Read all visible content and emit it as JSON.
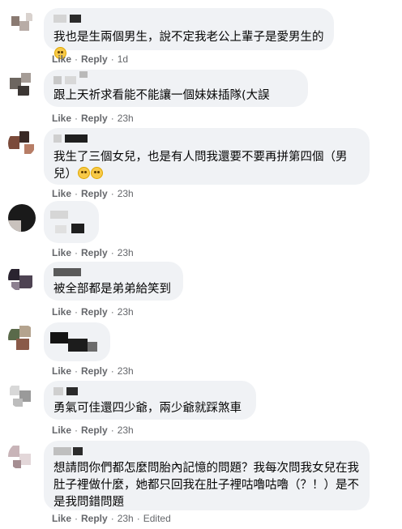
{
  "like_label": "Like",
  "reply_label": "Reply",
  "separator": "·",
  "comments": [
    {
      "text": "我也是生兩個男生，說不定我老公上輩子是愛男生的",
      "emoji": "grinning-face-icon",
      "time": "1d",
      "edited": ""
    },
    {
      "text": "跟上天祈求看能不能讓一個妹妹插隊(大誤",
      "time": "23h",
      "edited": ""
    },
    {
      "text": "我生了三個女兒，也是有人問我還要不要再拼第四個（男兒）",
      "emoji": "rolling-eyes-face-icon",
      "time": "23h",
      "edited": ""
    },
    {
      "text": "",
      "time": "23h",
      "edited": ""
    },
    {
      "text": "被全部都是弟弟給笑到",
      "time": "23h",
      "edited": ""
    },
    {
      "text": "",
      "time": "23h",
      "edited": ""
    },
    {
      "text": "勇氣可佳還四少爺，兩少爺就踩煞車",
      "time": "23h",
      "edited": ""
    },
    {
      "text": "想請問你們都怎麼問胎內記憶的問題？我每次問我女兒在我肚子裡做什麼，她都只回我在肚子裡咕嚕咕嚕（？！）是不是我問錯問題",
      "time": "23h",
      "edited": "Edited"
    }
  ]
}
